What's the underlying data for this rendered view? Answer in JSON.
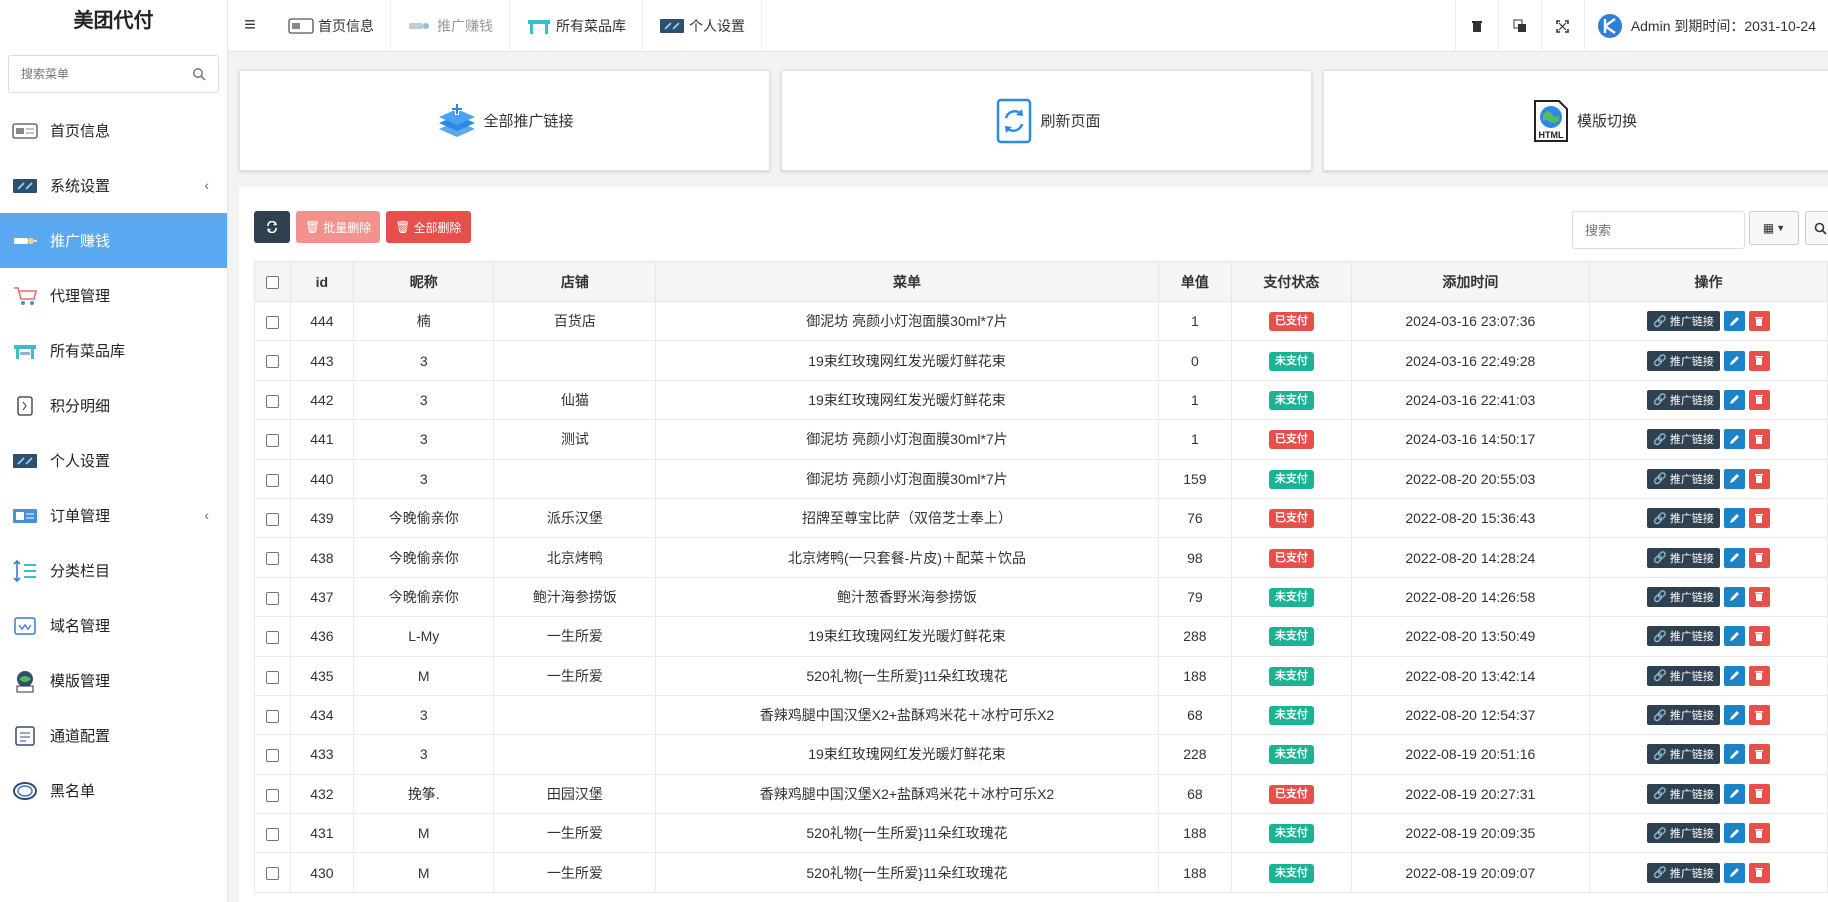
{
  "brand": "美团代付",
  "sidebar": {
    "search_placeholder": "搜索菜单",
    "items": [
      {
        "label": "首页信息",
        "icon": "home-info-icon"
      },
      {
        "label": "系统设置",
        "icon": "system-settings-icon",
        "has_caret": true
      },
      {
        "label": "推广赚钱",
        "icon": "promote-icon",
        "active": true
      },
      {
        "label": "代理管理",
        "icon": "agent-icon"
      },
      {
        "label": "所有菜品库",
        "icon": "dish-library-icon"
      },
      {
        "label": "积分明细",
        "icon": "points-icon"
      },
      {
        "label": "个人设置",
        "icon": "personal-settings-icon"
      },
      {
        "label": "订单管理",
        "icon": "orders-icon",
        "has_caret": true
      },
      {
        "label": "分类栏目",
        "icon": "category-icon"
      },
      {
        "label": "域名管理",
        "icon": "domain-icon"
      },
      {
        "label": "模版管理",
        "icon": "template-icon"
      },
      {
        "label": "通道配置",
        "icon": "channel-icon"
      },
      {
        "label": "黑名单",
        "icon": "blacklist-icon"
      }
    ]
  },
  "topbar": {
    "tabs": [
      {
        "label": "首页信息"
      },
      {
        "label": "推广赚钱"
      },
      {
        "label": "所有菜品库"
      },
      {
        "label": "个人设置"
      }
    ],
    "admin_text": "Admin 到期时间：2031-10-24"
  },
  "cards": [
    {
      "label": "全部推广链接"
    },
    {
      "label": "刷新页面"
    },
    {
      "label": "模版切换"
    }
  ],
  "toolbar": {
    "batch_delete": "批量删除",
    "delete_all": "全部删除",
    "search_placeholder": "搜索"
  },
  "table": {
    "headers": [
      "id",
      "昵称",
      "店铺",
      "菜单",
      "单值",
      "支付状态",
      "添加时间",
      "操作"
    ],
    "op_link_label": "推广链接",
    "rows": [
      {
        "id": "444",
        "nick": "楠",
        "shop": "百货店",
        "menu": "御泥坊 亮颜小灯泡面膜30ml*7片",
        "price": "1",
        "status": "已支付",
        "paid": true,
        "time": "2024-03-16 23:07:36"
      },
      {
        "id": "443",
        "nick": "3",
        "shop": "",
        "menu": "19束红玫瑰网红发光暖灯鲜花束",
        "price": "0",
        "status": "未支付",
        "paid": false,
        "time": "2024-03-16 22:49:28"
      },
      {
        "id": "442",
        "nick": "3",
        "shop": "仙猫",
        "menu": "19束红玫瑰网红发光暖灯鲜花束",
        "price": "1",
        "status": "未支付",
        "paid": false,
        "time": "2024-03-16 22:41:03"
      },
      {
        "id": "441",
        "nick": "3",
        "shop": "测试",
        "menu": "御泥坊 亮颜小灯泡面膜30ml*7片",
        "price": "1",
        "status": "已支付",
        "paid": true,
        "time": "2024-03-16 14:50:17"
      },
      {
        "id": "440",
        "nick": "3",
        "shop": "",
        "menu": "御泥坊 亮颜小灯泡面膜30ml*7片",
        "price": "159",
        "status": "未支付",
        "paid": false,
        "time": "2022-08-20 20:55:03"
      },
      {
        "id": "439",
        "nick": "今晚偷亲你",
        "shop": "派乐汉堡",
        "menu": "招牌至尊宝比萨（双倍芝士奉上）",
        "price": "76",
        "status": "已支付",
        "paid": true,
        "time": "2022-08-20 15:36:43"
      },
      {
        "id": "438",
        "nick": "今晚偷亲你",
        "shop": "北京烤鸭",
        "menu": "北京烤鸭(一只套餐-片皮)＋配菜＋饮品",
        "price": "98",
        "status": "已支付",
        "paid": true,
        "time": "2022-08-20 14:28:24"
      },
      {
        "id": "437",
        "nick": "今晚偷亲你",
        "shop": "鲍汁海参捞饭",
        "menu": "鲍汁葱香野米海参捞饭",
        "price": "79",
        "status": "未支付",
        "paid": false,
        "time": "2022-08-20 14:26:58"
      },
      {
        "id": "436",
        "nick": "L-My",
        "shop": "一生所爱",
        "menu": "19束红玫瑰网红发光暖灯鲜花束",
        "price": "288",
        "status": "未支付",
        "paid": false,
        "time": "2022-08-20 13:50:49"
      },
      {
        "id": "435",
        "nick": "M",
        "shop": "一生所爱",
        "menu": "520礼物{一生所爱}11朵红玫瑰花",
        "price": "188",
        "status": "未支付",
        "paid": false,
        "time": "2022-08-20 13:42:14"
      },
      {
        "id": "434",
        "nick": "3",
        "shop": "",
        "menu": "香辣鸡腿中国汉堡X2+盐酥鸡米花＋冰柠可乐X2",
        "price": "68",
        "status": "未支付",
        "paid": false,
        "time": "2022-08-20 12:54:37"
      },
      {
        "id": "433",
        "nick": "3",
        "shop": "",
        "menu": "19束红玫瑰网红发光暖灯鲜花束",
        "price": "228",
        "status": "未支付",
        "paid": false,
        "time": "2022-08-19 20:51:16"
      },
      {
        "id": "432",
        "nick": "挽筝.",
        "shop": "田园汉堡",
        "menu": "香辣鸡腿中国汉堡X2+盐酥鸡米花＋冰柠可乐X2",
        "price": "68",
        "status": "已支付",
        "paid": true,
        "time": "2022-08-19 20:27:31"
      },
      {
        "id": "431",
        "nick": "M",
        "shop": "一生所爱",
        "menu": "520礼物{一生所爱}11朵红玫瑰花",
        "price": "188",
        "status": "未支付",
        "paid": false,
        "time": "2022-08-19 20:09:35"
      },
      {
        "id": "430",
        "nick": "M",
        "shop": "一生所爱",
        "menu": "520礼物{一生所爱}11朵红玫瑰花",
        "price": "188",
        "status": "未支付",
        "paid": false,
        "time": "2022-08-19 20:09:07"
      }
    ]
  },
  "colors": {
    "active_menu": "#5aa8f0",
    "dark_button": "#2f4050",
    "danger": "#e7504a",
    "success": "#1ab394",
    "edit": "#1c84c6"
  }
}
